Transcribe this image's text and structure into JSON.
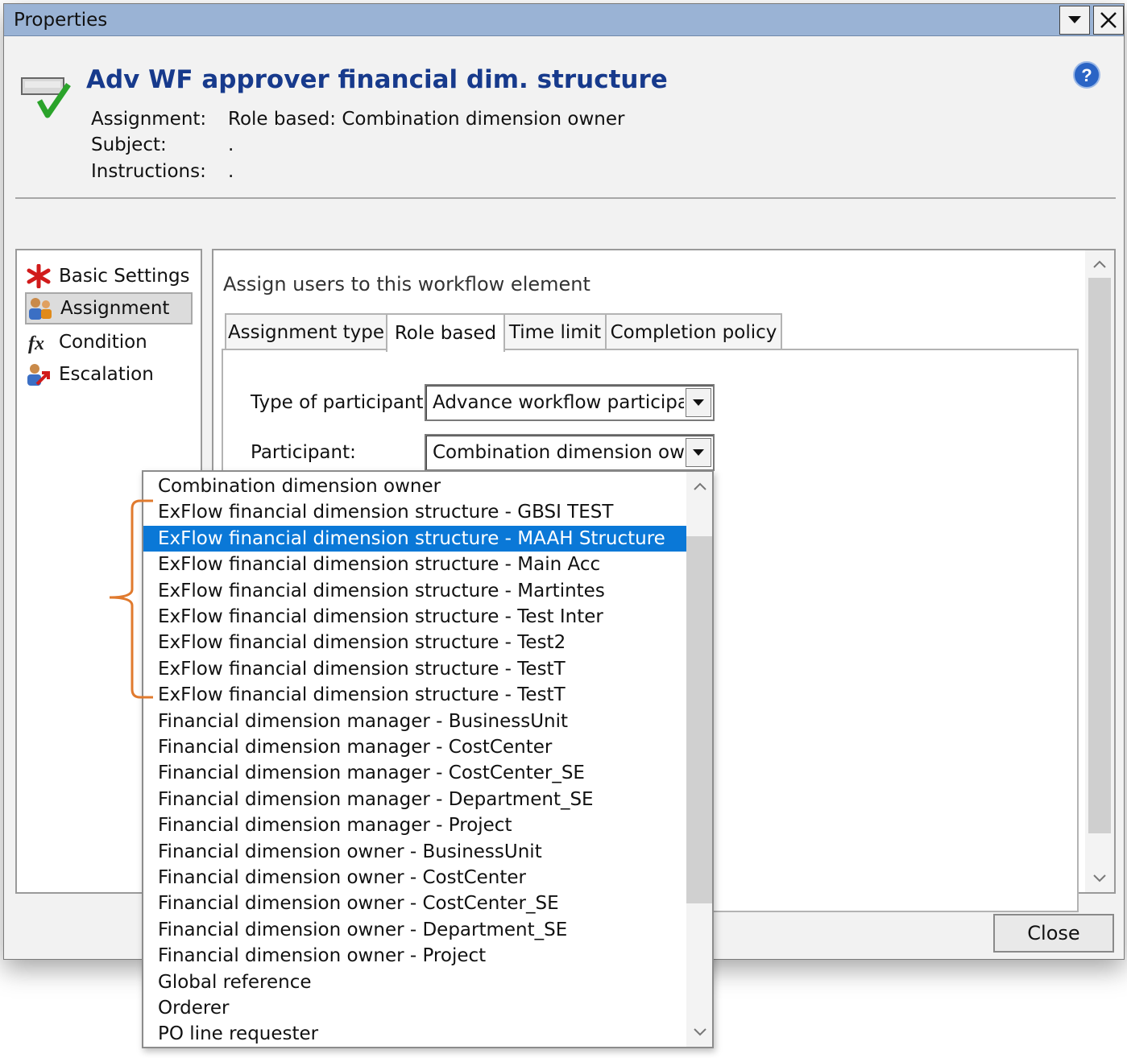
{
  "window": {
    "title": "Properties"
  },
  "header": {
    "title": "Adv WF approver financial dim. structure",
    "rows": [
      {
        "label": "Assignment:",
        "value": "Role based: Combination dimension owner"
      },
      {
        "label": "Subject:",
        "value": "."
      },
      {
        "label": "Instructions:",
        "value": "."
      }
    ]
  },
  "nav": {
    "items": [
      {
        "label": "Basic Settings",
        "icon": "asterisk-icon"
      },
      {
        "label": "Assignment",
        "icon": "users-icon",
        "selected": true
      },
      {
        "label": "Condition",
        "icon": "function-icon"
      },
      {
        "label": "Escalation",
        "icon": "escalation-icon"
      }
    ]
  },
  "content": {
    "section_title": "Assign users to this workflow element",
    "tabs": [
      {
        "label": "Assignment type"
      },
      {
        "label": "Role based",
        "active": true
      },
      {
        "label": "Time limit"
      },
      {
        "label": "Completion policy"
      }
    ],
    "type_of_participant": {
      "label": "Type of participant:",
      "value": "Advance workflow participan"
    },
    "participant": {
      "label": "Participant:",
      "value": "Combination dimension own"
    }
  },
  "dropdown": {
    "selected_index": 2,
    "items": [
      "Combination dimension owner",
      "ExFlow financial dimension structure - GBSI TEST",
      "ExFlow financial dimension structure - MAAH Structure",
      "ExFlow financial dimension structure - Main Acc",
      "ExFlow financial dimension structure - Martintes",
      "ExFlow financial dimension structure - Test Inter",
      "ExFlow financial dimension structure - Test2",
      "ExFlow financial dimension structure - TestT",
      "ExFlow financial dimension structure - TestT",
      "Financial dimension manager - BusinessUnit",
      "Financial dimension manager - CostCenter",
      "Financial dimension manager - CostCenter_SE",
      "Financial dimension manager - Department_SE",
      "Financial dimension manager - Project",
      "Financial dimension owner - BusinessUnit",
      "Financial dimension owner - CostCenter",
      "Financial dimension owner - CostCenter_SE",
      "Financial dimension owner - Department_SE",
      "Financial dimension owner - Project",
      "Global reference",
      "Orderer",
      "PO line requester"
    ]
  },
  "footer": {
    "close_label": "Close"
  },
  "colors": {
    "titlebar": "#9ab3d5",
    "title_text": "#173a8c",
    "selection": "#0a78d7",
    "annotation_bracket": "#e07a2e"
  }
}
